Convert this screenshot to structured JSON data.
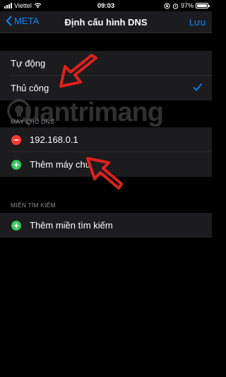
{
  "status_bar": {
    "carrier": "Viettel",
    "time": "09:03",
    "battery_percent": "97%",
    "battery_level": 0.97
  },
  "nav": {
    "back_label": "META",
    "title": "Định cấu hình DNS",
    "save_label": "Lưu"
  },
  "config_options": [
    {
      "label": "Tự động",
      "selected": false
    },
    {
      "label": "Thủ công",
      "selected": true
    }
  ],
  "dns_section": {
    "header": "MÁY CHỦ DNS",
    "servers": [
      "192.168.0.1"
    ],
    "add_label": "Thêm máy chủ"
  },
  "search_section": {
    "header": "MIỀN TÌM KIẾM",
    "add_label": "Thêm miền tìm kiếm"
  },
  "watermark": {
    "text": "uantrimang"
  },
  "colors": {
    "accent": "#0a84ff",
    "delete": "#ff3b30",
    "add": "#34c759",
    "annotation_arrow": "#e0201c",
    "cell_background": "#1c1c1e"
  },
  "icons": {
    "back": "chevron-left-icon",
    "check": "checkmark-icon",
    "delete": "minus-circle-icon",
    "add": "plus-circle-icon"
  }
}
